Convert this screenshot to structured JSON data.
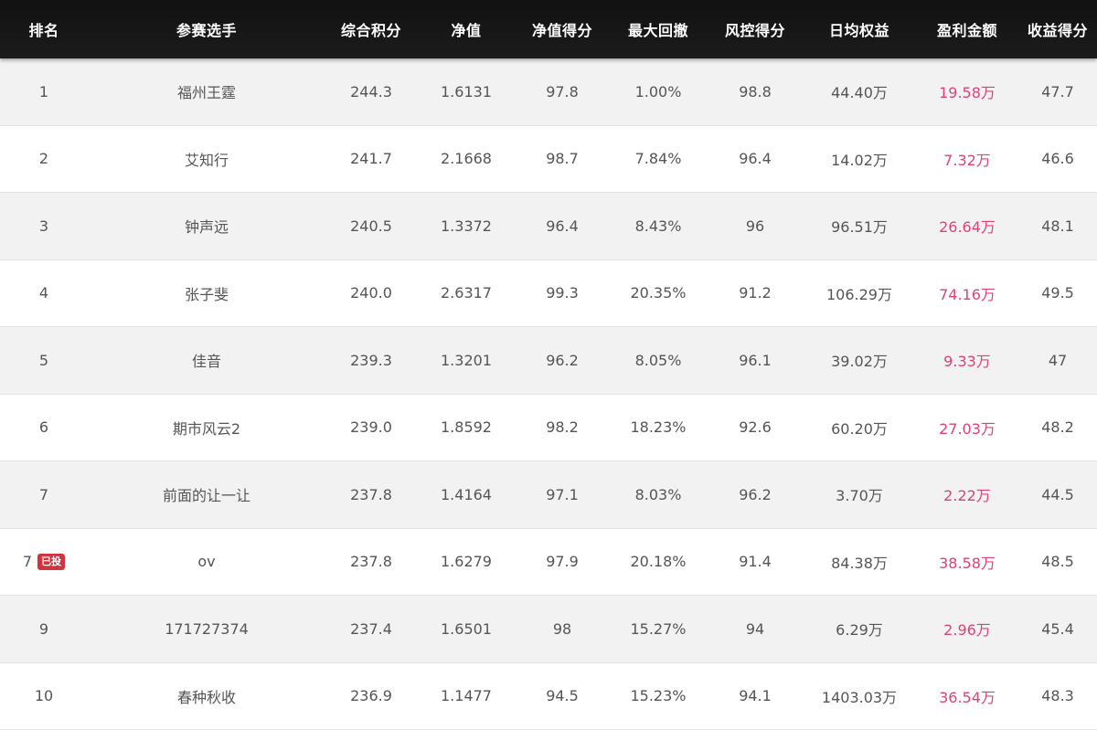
{
  "headers": {
    "rank": "排名",
    "player": "参赛选手",
    "score": "综合积分",
    "nav": "净值",
    "nav_score": "净值得分",
    "max_drawdown": "最大回撤",
    "risk_score": "风控得分",
    "daily_equity": "日均权益",
    "profit": "盈利金额",
    "return_score": "收益得分"
  },
  "colors": {
    "header_bg": "#151515",
    "profit": "#e0407a",
    "badge": "#d0343f",
    "row_alt": "#f2f2f2"
  },
  "rows": [
    {
      "rank": "1",
      "badge": "",
      "player": "福州王霆",
      "score": "244.3",
      "nav": "1.6131",
      "nav_score": "97.8",
      "max_drawdown": "1.00%",
      "risk_score": "98.8",
      "daily_equity": "44.40万",
      "profit": "19.58万",
      "return_score": "47.7"
    },
    {
      "rank": "2",
      "badge": "",
      "player": "艾知行",
      "score": "241.7",
      "nav": "2.1668",
      "nav_score": "98.7",
      "max_drawdown": "7.84%",
      "risk_score": "96.4",
      "daily_equity": "14.02万",
      "profit": "7.32万",
      "return_score": "46.6"
    },
    {
      "rank": "3",
      "badge": "",
      "player": "钟声远",
      "score": "240.5",
      "nav": "1.3372",
      "nav_score": "96.4",
      "max_drawdown": "8.43%",
      "risk_score": "96",
      "daily_equity": "96.51万",
      "profit": "26.64万",
      "return_score": "48.1"
    },
    {
      "rank": "4",
      "badge": "",
      "player": "张子斐",
      "score": "240.0",
      "nav": "2.6317",
      "nav_score": "99.3",
      "max_drawdown": "20.35%",
      "risk_score": "91.2",
      "daily_equity": "106.29万",
      "profit": "74.16万",
      "return_score": "49.5"
    },
    {
      "rank": "5",
      "badge": "",
      "player": "佳音",
      "score": "239.3",
      "nav": "1.3201",
      "nav_score": "96.2",
      "max_drawdown": "8.05%",
      "risk_score": "96.1",
      "daily_equity": "39.02万",
      "profit": "9.33万",
      "return_score": "47"
    },
    {
      "rank": "6",
      "badge": "",
      "player": "期市风云2",
      "score": "239.0",
      "nav": "1.8592",
      "nav_score": "98.2",
      "max_drawdown": "18.23%",
      "risk_score": "92.6",
      "daily_equity": "60.20万",
      "profit": "27.03万",
      "return_score": "48.2"
    },
    {
      "rank": "7",
      "badge": "",
      "player": "前面的让一让",
      "score": "237.8",
      "nav": "1.4164",
      "nav_score": "97.1",
      "max_drawdown": "8.03%",
      "risk_score": "96.2",
      "daily_equity": "3.70万",
      "profit": "2.22万",
      "return_score": "44.5"
    },
    {
      "rank": "7",
      "badge": "已投",
      "player": "ov",
      "score": "237.8",
      "nav": "1.6279",
      "nav_score": "97.9",
      "max_drawdown": "20.18%",
      "risk_score": "91.4",
      "daily_equity": "84.38万",
      "profit": "38.58万",
      "return_score": "48.5"
    },
    {
      "rank": "9",
      "badge": "",
      "player": "171727374",
      "score": "237.4",
      "nav": "1.6501",
      "nav_score": "98",
      "max_drawdown": "15.27%",
      "risk_score": "94",
      "daily_equity": "6.29万",
      "profit": "2.96万",
      "return_score": "45.4"
    },
    {
      "rank": "10",
      "badge": "",
      "player": "春种秋收",
      "score": "236.9",
      "nav": "1.1477",
      "nav_score": "94.5",
      "max_drawdown": "15.23%",
      "risk_score": "94.1",
      "daily_equity": "1403.03万",
      "profit": "36.54万",
      "return_score": "48.3"
    }
  ]
}
